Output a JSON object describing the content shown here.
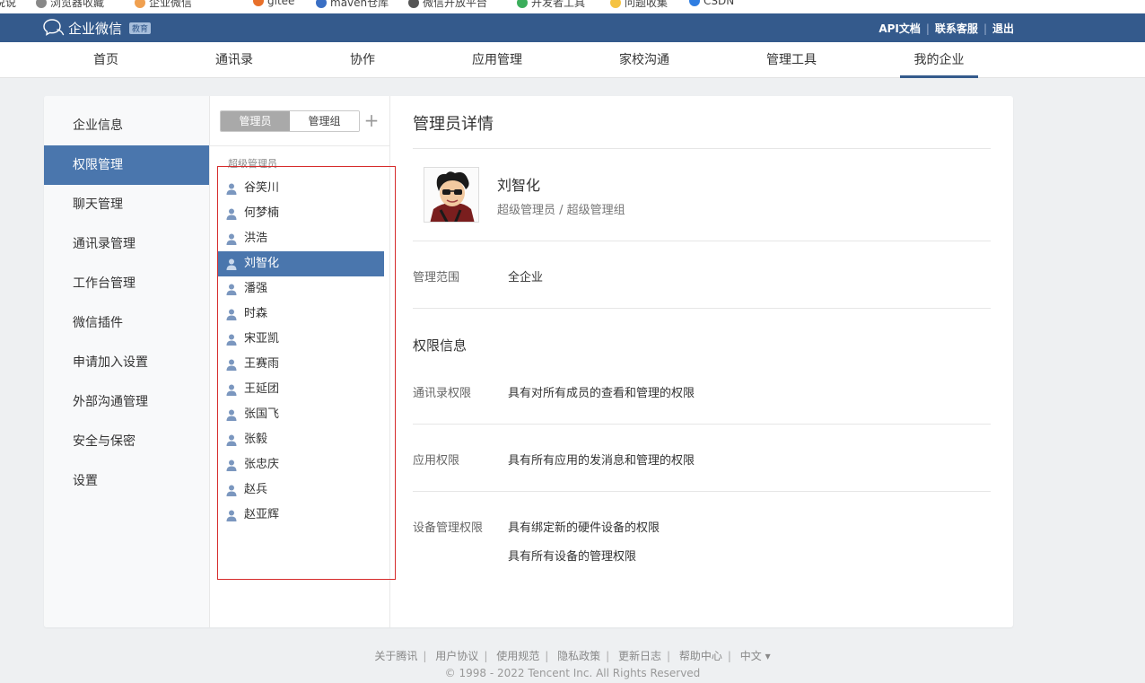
{
  "bookmarks": [
    "说说",
    "浏览器收藏",
    "企业微信",
    "gitee",
    "maven仓库",
    "微信开放平台",
    "开发者工具",
    "问题收集",
    "CSDN"
  ],
  "header": {
    "logo_text": "企业微信",
    "logo_badge": "教育",
    "links": [
      "API文档",
      "联系客服",
      "退出"
    ]
  },
  "nav": {
    "items": [
      "首页",
      "通讯录",
      "协作",
      "应用管理",
      "家校沟通",
      "管理工具",
      "我的企业"
    ],
    "active_index": 6
  },
  "sidebar": {
    "items": [
      "企业信息",
      "权限管理",
      "聊天管理",
      "通讯录管理",
      "工作台管理",
      "微信插件",
      "申请加入设置",
      "外部沟通管理",
      "安全与保密",
      "设置"
    ],
    "active_index": 1
  },
  "admin_panel": {
    "tabs": [
      "管理员",
      "管理组"
    ],
    "active_tab": 0,
    "add_symbol": "+",
    "group_title": "超级管理员",
    "admins": [
      "谷笑川",
      "何梦楠",
      "洪浩",
      "刘智化",
      "潘强",
      "时森",
      "宋亚凯",
      "王赛雨",
      "王延团",
      "张国飞",
      "张毅",
      "张忠庆",
      "赵兵",
      "赵亚辉"
    ],
    "selected_index": 3
  },
  "detail": {
    "title": "管理员详情",
    "name": "刘智化",
    "role": "超级管理员 / 超级管理组",
    "scope_label": "管理范围",
    "scope_value": "全企业",
    "permissions_title": "权限信息",
    "contacts_label": "通讯录权限",
    "contacts_value": "具有对所有成员的查看和管理的权限",
    "apps_label": "应用权限",
    "apps_value": "具有所有应用的发消息和管理的权限",
    "devices_label": "设备管理权限",
    "devices_values": [
      "具有绑定新的硬件设备的权限",
      "具有所有设备的管理权限"
    ]
  },
  "footer": {
    "links": [
      "关于腾讯",
      "用户协议",
      "使用规范",
      "隐私政策",
      "更新日志",
      "帮助中心"
    ],
    "language": "中文 ▾",
    "copyright": "© 1998 - 2022 Tencent Inc. All Rights Reserved"
  },
  "colors": {
    "header_bg": "#345a8c",
    "accent": "#4a76ad",
    "highlight_border": "#d62c2c"
  },
  "icons": {
    "logo": "chat-bubbles-icon",
    "user": "user-icon",
    "add": "plus-icon"
  }
}
